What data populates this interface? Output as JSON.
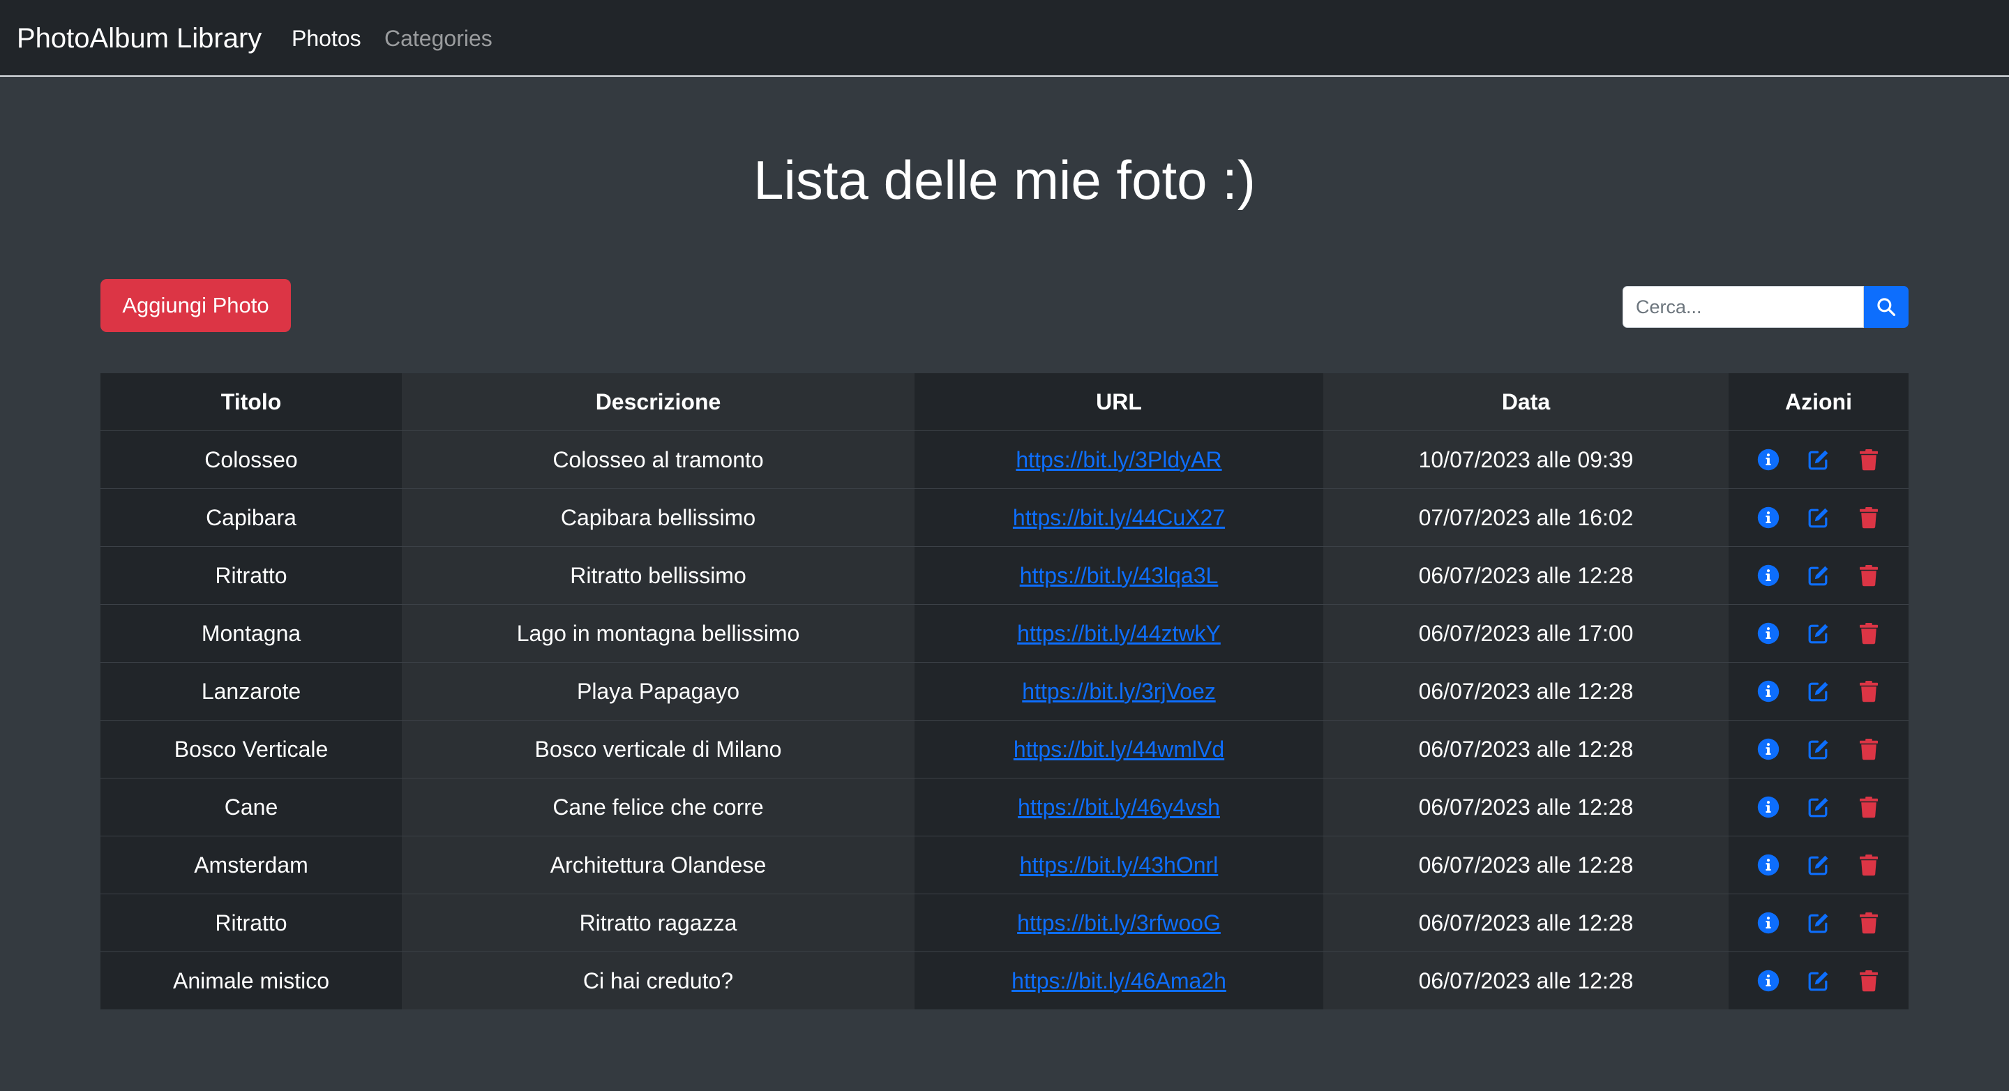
{
  "navbar": {
    "brand": "PhotoAlbum Library",
    "links": [
      "Photos",
      "Categories"
    ]
  },
  "page": {
    "title": "Lista delle mie foto :)"
  },
  "toolbar": {
    "add_label": "Aggiungi Photo",
    "search_placeholder": "Cerca...",
    "search_icon": "search-icon"
  },
  "table": {
    "headers": [
      "Titolo",
      "Descrizione",
      "URL",
      "Data",
      "Azioni"
    ],
    "action_icons": [
      "info-icon",
      "edit-icon",
      "trash-icon"
    ],
    "rows": [
      {
        "title": "Colosseo",
        "description": "Colosseo al tramonto",
        "url": "https://bit.ly/3PldyAR",
        "date": "10/07/2023 alle 09:39"
      },
      {
        "title": "Capibara",
        "description": "Capibara bellissimo",
        "url": "https://bit.ly/44CuX27",
        "date": "07/07/2023 alle 16:02"
      },
      {
        "title": "Ritratto",
        "description": "Ritratto bellissimo",
        "url": "https://bit.ly/43lqa3L",
        "date": "06/07/2023 alle 12:28"
      },
      {
        "title": "Montagna",
        "description": "Lago in montagna bellissimo",
        "url": "https://bit.ly/44ztwkY",
        "date": "06/07/2023 alle 17:00"
      },
      {
        "title": "Lanzarote",
        "description": "Playa Papagayo",
        "url": "https://bit.ly/3rjVoez",
        "date": "06/07/2023 alle 12:28"
      },
      {
        "title": "Bosco Verticale",
        "description": "Bosco verticale di Milano",
        "url": "https://bit.ly/44wmlVd",
        "date": "06/07/2023 alle 12:28"
      },
      {
        "title": "Cane",
        "description": "Cane felice che corre",
        "url": "https://bit.ly/46y4vsh",
        "date": "06/07/2023 alle 12:28"
      },
      {
        "title": "Amsterdam",
        "description": "Architettura Olandese",
        "url": "https://bit.ly/43hOnrl",
        "date": "06/07/2023 alle 12:28"
      },
      {
        "title": "Ritratto",
        "description": "Ritratto ragazza",
        "url": "https://bit.ly/3rfwooG",
        "date": "06/07/2023 alle 12:28"
      },
      {
        "title": "Animale mistico",
        "description": "Ci hai creduto?",
        "url": "https://bit.ly/46Ama2h",
        "date": "06/07/2023 alle 12:28"
      }
    ]
  },
  "colors": {
    "navbar_bg": "#212529",
    "page_bg": "#343a40",
    "danger": "#dc3545",
    "primary": "#0d6efd",
    "table_dark": "#212529",
    "table_mid": "#2c3034"
  }
}
